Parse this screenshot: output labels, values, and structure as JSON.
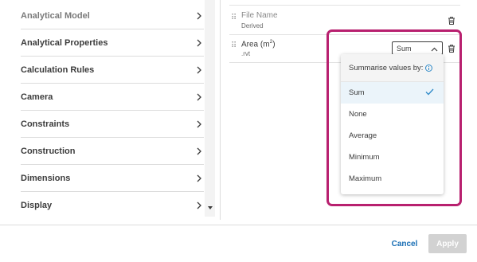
{
  "categories": [
    {
      "label": "Analytical Model",
      "dim": true
    },
    {
      "label": "Analytical Properties",
      "dim": false
    },
    {
      "label": "Calculation Rules",
      "dim": false
    },
    {
      "label": "Camera",
      "dim": false
    },
    {
      "label": "Constraints",
      "dim": false
    },
    {
      "label": "Construction",
      "dim": false
    },
    {
      "label": "Dimensions",
      "dim": false
    },
    {
      "label": "Display",
      "dim": false
    }
  ],
  "fields": [
    {
      "name": "File Name",
      "source": "Derived"
    },
    {
      "name_prefix": "Area (m",
      "name_sup": "2",
      "name_suffix": ")",
      "source": ".rvt",
      "aggregation": "Sum"
    }
  ],
  "dropdown": {
    "header": "Summarise values by:",
    "options": [
      "Sum",
      "None",
      "Average",
      "Minimum",
      "Maximum"
    ],
    "selected": "Sum"
  },
  "footer": {
    "cancel_label": "Cancel",
    "apply_label": "Apply"
  },
  "colors": {
    "highlight": "#b8206f",
    "accent": "#1a6fb5",
    "check": "#2f8ac8",
    "selected_bg": "#ebf4fa"
  },
  "icons": {
    "chevron": "chevron-right-icon",
    "grip": "drag-handle-icon",
    "trash": "trash-icon",
    "caret": "chevron-up-icon",
    "check": "check-icon",
    "info": "info-icon"
  }
}
